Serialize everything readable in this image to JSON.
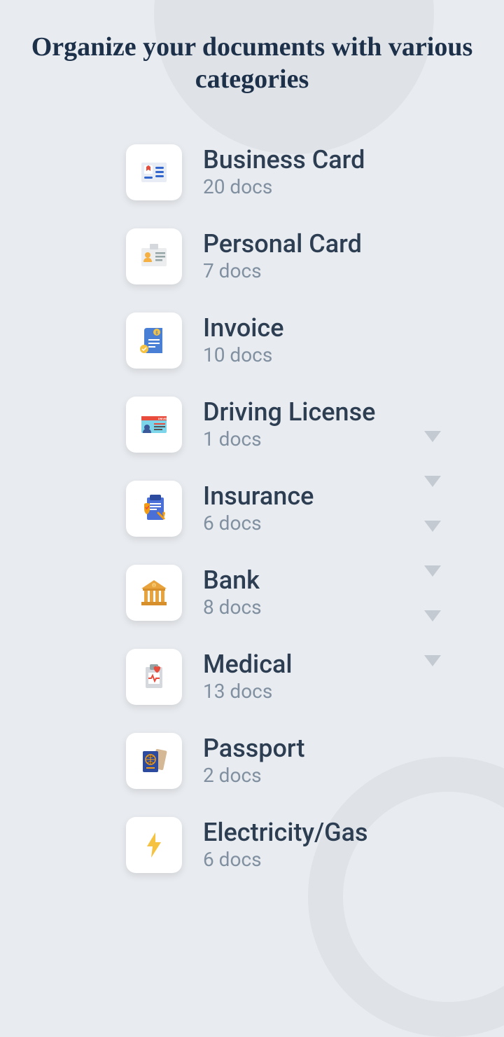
{
  "heading": "Organize your documents with various categories",
  "categories": [
    {
      "title": "Business Card",
      "count": "20 docs"
    },
    {
      "title": "Personal Card",
      "count": "7 docs"
    },
    {
      "title": "Invoice",
      "count": "10 docs"
    },
    {
      "title": "Driving License",
      "count": "1 docs"
    },
    {
      "title": "Insurance",
      "count": "6 docs"
    },
    {
      "title": "Bank",
      "count": "8 docs"
    },
    {
      "title": "Medical",
      "count": "13 docs"
    },
    {
      "title": "Passport",
      "count": "2 docs"
    },
    {
      "title": "Electricity/Gas",
      "count": "6 docs"
    }
  ]
}
